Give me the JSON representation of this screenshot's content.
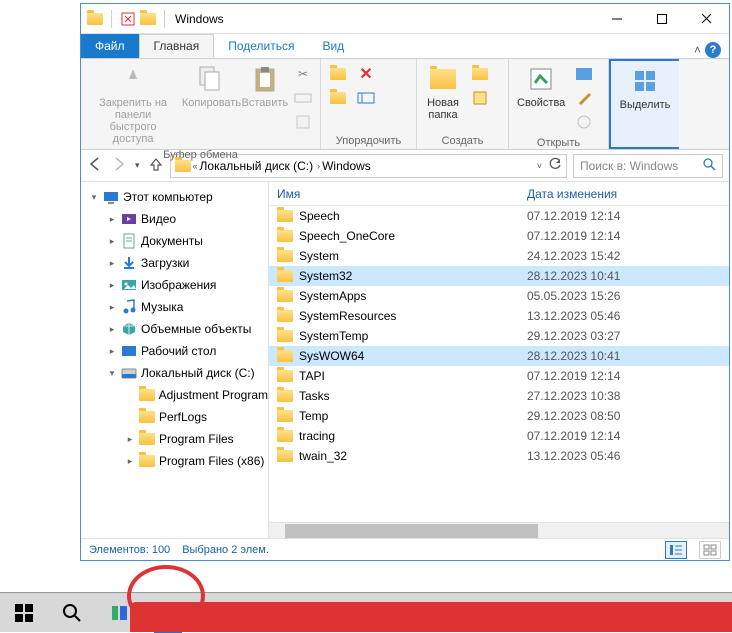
{
  "titlebar": {
    "title": "Windows"
  },
  "tabs": {
    "file": "Файл",
    "home": "Главная",
    "share": "Поделиться",
    "view": "Вид"
  },
  "ribbon": {
    "clipboard": {
      "label": "Буфер обмена",
      "pin": "Закрепить на панели\nбыстрого доступа",
      "copy": "Копировать",
      "paste": "Вставить"
    },
    "organize": {
      "label": "Упорядочить"
    },
    "create": {
      "label": "Создать",
      "newfolder": "Новая\nпапка"
    },
    "open": {
      "label": "Открыть",
      "properties": "Свойства"
    },
    "select": {
      "label": "",
      "select_btn": "Выделить"
    }
  },
  "breadcrumb": {
    "parts": [
      "Локальный диск (C:)",
      "Windows"
    ]
  },
  "search": {
    "placeholder": "Поиск в: Windows"
  },
  "tree": [
    {
      "indent": 0,
      "exp": "▾",
      "icon": "pc",
      "label": "Этот компьютер"
    },
    {
      "indent": 1,
      "exp": "▸",
      "icon": "video",
      "label": "Видео"
    },
    {
      "indent": 1,
      "exp": "▸",
      "icon": "docs",
      "label": "Документы"
    },
    {
      "indent": 1,
      "exp": "▸",
      "icon": "dl",
      "label": "Загрузки"
    },
    {
      "indent": 1,
      "exp": "▸",
      "icon": "img",
      "label": "Изображения"
    },
    {
      "indent": 1,
      "exp": "▸",
      "icon": "music",
      "label": "Музыка"
    },
    {
      "indent": 1,
      "exp": "▸",
      "icon": "3d",
      "label": "Объемные объекты"
    },
    {
      "indent": 1,
      "exp": "▸",
      "icon": "desk",
      "label": "Рабочий стол"
    },
    {
      "indent": 1,
      "exp": "▾",
      "icon": "disk",
      "label": "Локальный диск (C:)"
    },
    {
      "indent": 2,
      "exp": "",
      "icon": "folder",
      "label": "Adjustment Program"
    },
    {
      "indent": 2,
      "exp": "",
      "icon": "folder",
      "label": "PerfLogs"
    },
    {
      "indent": 2,
      "exp": "▸",
      "icon": "folder",
      "label": "Program Files"
    },
    {
      "indent": 2,
      "exp": "▸",
      "icon": "folder",
      "label": "Program Files (x86)"
    }
  ],
  "columns": {
    "name": "Имя",
    "date": "Дата изменения"
  },
  "files": [
    {
      "name": "Speech",
      "date": "07.12.2019 12:14",
      "selected": false
    },
    {
      "name": "Speech_OneCore",
      "date": "07.12.2019 12:14",
      "selected": false
    },
    {
      "name": "System",
      "date": "24.12.2023 15:42",
      "selected": false
    },
    {
      "name": "System32",
      "date": "28.12.2023 10:41",
      "selected": true
    },
    {
      "name": "SystemApps",
      "date": "05.05.2023 15:26",
      "selected": false
    },
    {
      "name": "SystemResources",
      "date": "13.12.2023 05:46",
      "selected": false
    },
    {
      "name": "SystemTemp",
      "date": "29.12.2023 03:27",
      "selected": false
    },
    {
      "name": "SysWOW64",
      "date": "28.12.2023 10:41",
      "selected": true
    },
    {
      "name": "TAPI",
      "date": "07.12.2019 12:14",
      "selected": false
    },
    {
      "name": "Tasks",
      "date": "27.12.2023 10:38",
      "selected": false
    },
    {
      "name": "Temp",
      "date": "29.12.2023 08:50",
      "selected": false
    },
    {
      "name": "tracing",
      "date": "07.12.2019 12:14",
      "selected": false
    },
    {
      "name": "twain_32",
      "date": "13.12.2023 05:46",
      "selected": false
    }
  ],
  "status": {
    "count": "Элементов: 100",
    "selected": "Выбрано 2 элем."
  }
}
